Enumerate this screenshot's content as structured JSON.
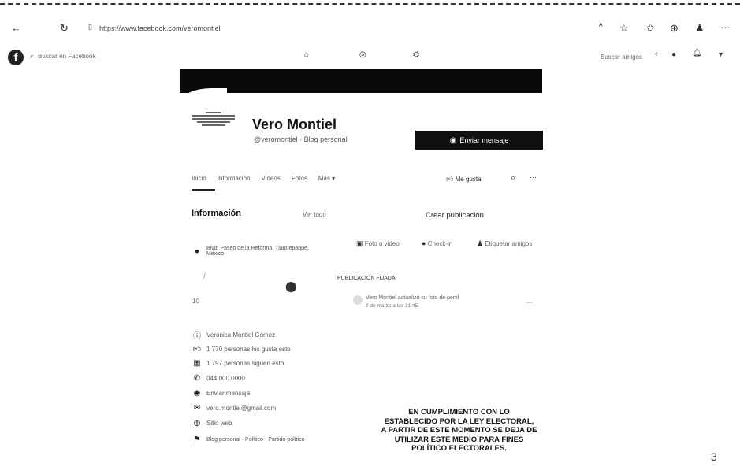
{
  "browser": {
    "url": "https://www.facebook.com/veromontiel",
    "icons": [
      "back-icon",
      "reload-icon",
      "lock-icon",
      "star-icon",
      "favorites-icon",
      "extension-icon",
      "profile-icon",
      "menu-icon"
    ]
  },
  "facebook": {
    "search_placeholder": "Buscar en Facebook",
    "find_friends": "Buscar amigos",
    "plus": "+"
  },
  "profile": {
    "name": "Vero Montiel",
    "handle": "@veromontiel · Blog personal",
    "message_button": "Enviar mensaje",
    "follow_label": "Me gusta",
    "tabs": [
      "Inicio",
      "Información",
      "Videos",
      "Fotos",
      "Más ▾"
    ],
    "more": "···"
  },
  "info": {
    "title": "Información",
    "see_all": "Ver todo",
    "address": "Blvd. Paseo de la Reforma, Tlaquepaque, México",
    "map_label": "10",
    "rows": [
      {
        "icon": "info-icon",
        "text": "Verónica Montiel Gómez"
      },
      {
        "icon": "like-icon",
        "text": "1 770 personas les gusta esto"
      },
      {
        "icon": "followers-icon",
        "text": "1 797 personas siguen esto"
      },
      {
        "icon": "phone-icon",
        "text": "044 000 0000"
      },
      {
        "icon": "messenger-icon",
        "text": "Enviar mensaje"
      },
      {
        "icon": "email-icon",
        "text": "vero.montiel@gmail.com"
      },
      {
        "icon": "website-icon",
        "text": "Sitio web"
      },
      {
        "icon": "category-icon",
        "text": "Blog personal · Político · Partido político"
      }
    ]
  },
  "posts": {
    "create_title": "Crear publicación",
    "actions": [
      "Foto o video",
      "Check-in",
      "Etiquetar amigos"
    ],
    "pinned_title": "PUBLICACIÓN FIJADA",
    "post_author": "Vero Montiel actualizó su foto de perfil",
    "post_date": "2 de marzo a las 21:45",
    "post_more": "···"
  },
  "notice": {
    "lines": [
      "EN CUMPLIMIENTO CON LO",
      "ESTABLECIDO POR LA LEY ELECTORAL,",
      "A PARTIR DE ESTE MOMENTO SE DEJA DE",
      "UTILIZAR ESTE MEDIO PARA FINES",
      "POLÍTICO ELECTORALES."
    ]
  },
  "page_number": "3"
}
